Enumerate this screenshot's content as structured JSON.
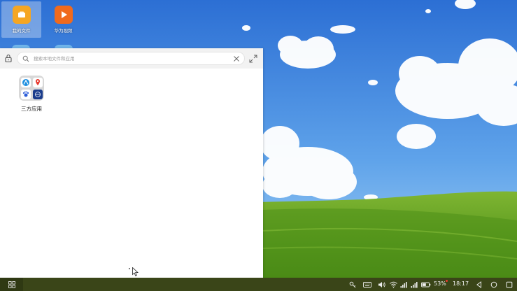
{
  "desktop": {
    "icons": [
      {
        "label": "我的文件",
        "icon": "folder-icon",
        "color": "#f5a623"
      },
      {
        "label": "华为视频",
        "icon": "play-icon",
        "color": "#f06a1d"
      }
    ]
  },
  "launcher": {
    "search": {
      "placeholder": "搜索本地文件和应用",
      "value": ""
    },
    "folders": [
      {
        "label": "三方应用",
        "apps": [
          "browser-icon",
          "map-pin-icon",
          "baidu-icon",
          "app-icon"
        ]
      }
    ]
  },
  "taskbar": {
    "battery_percent": "53%",
    "clock": "18:17"
  },
  "colors": {
    "sky_top": "#2f73d6",
    "sky_bottom": "#9fcdf3",
    "grass": "#5c9a1e",
    "taskbar": "#3a4518"
  }
}
